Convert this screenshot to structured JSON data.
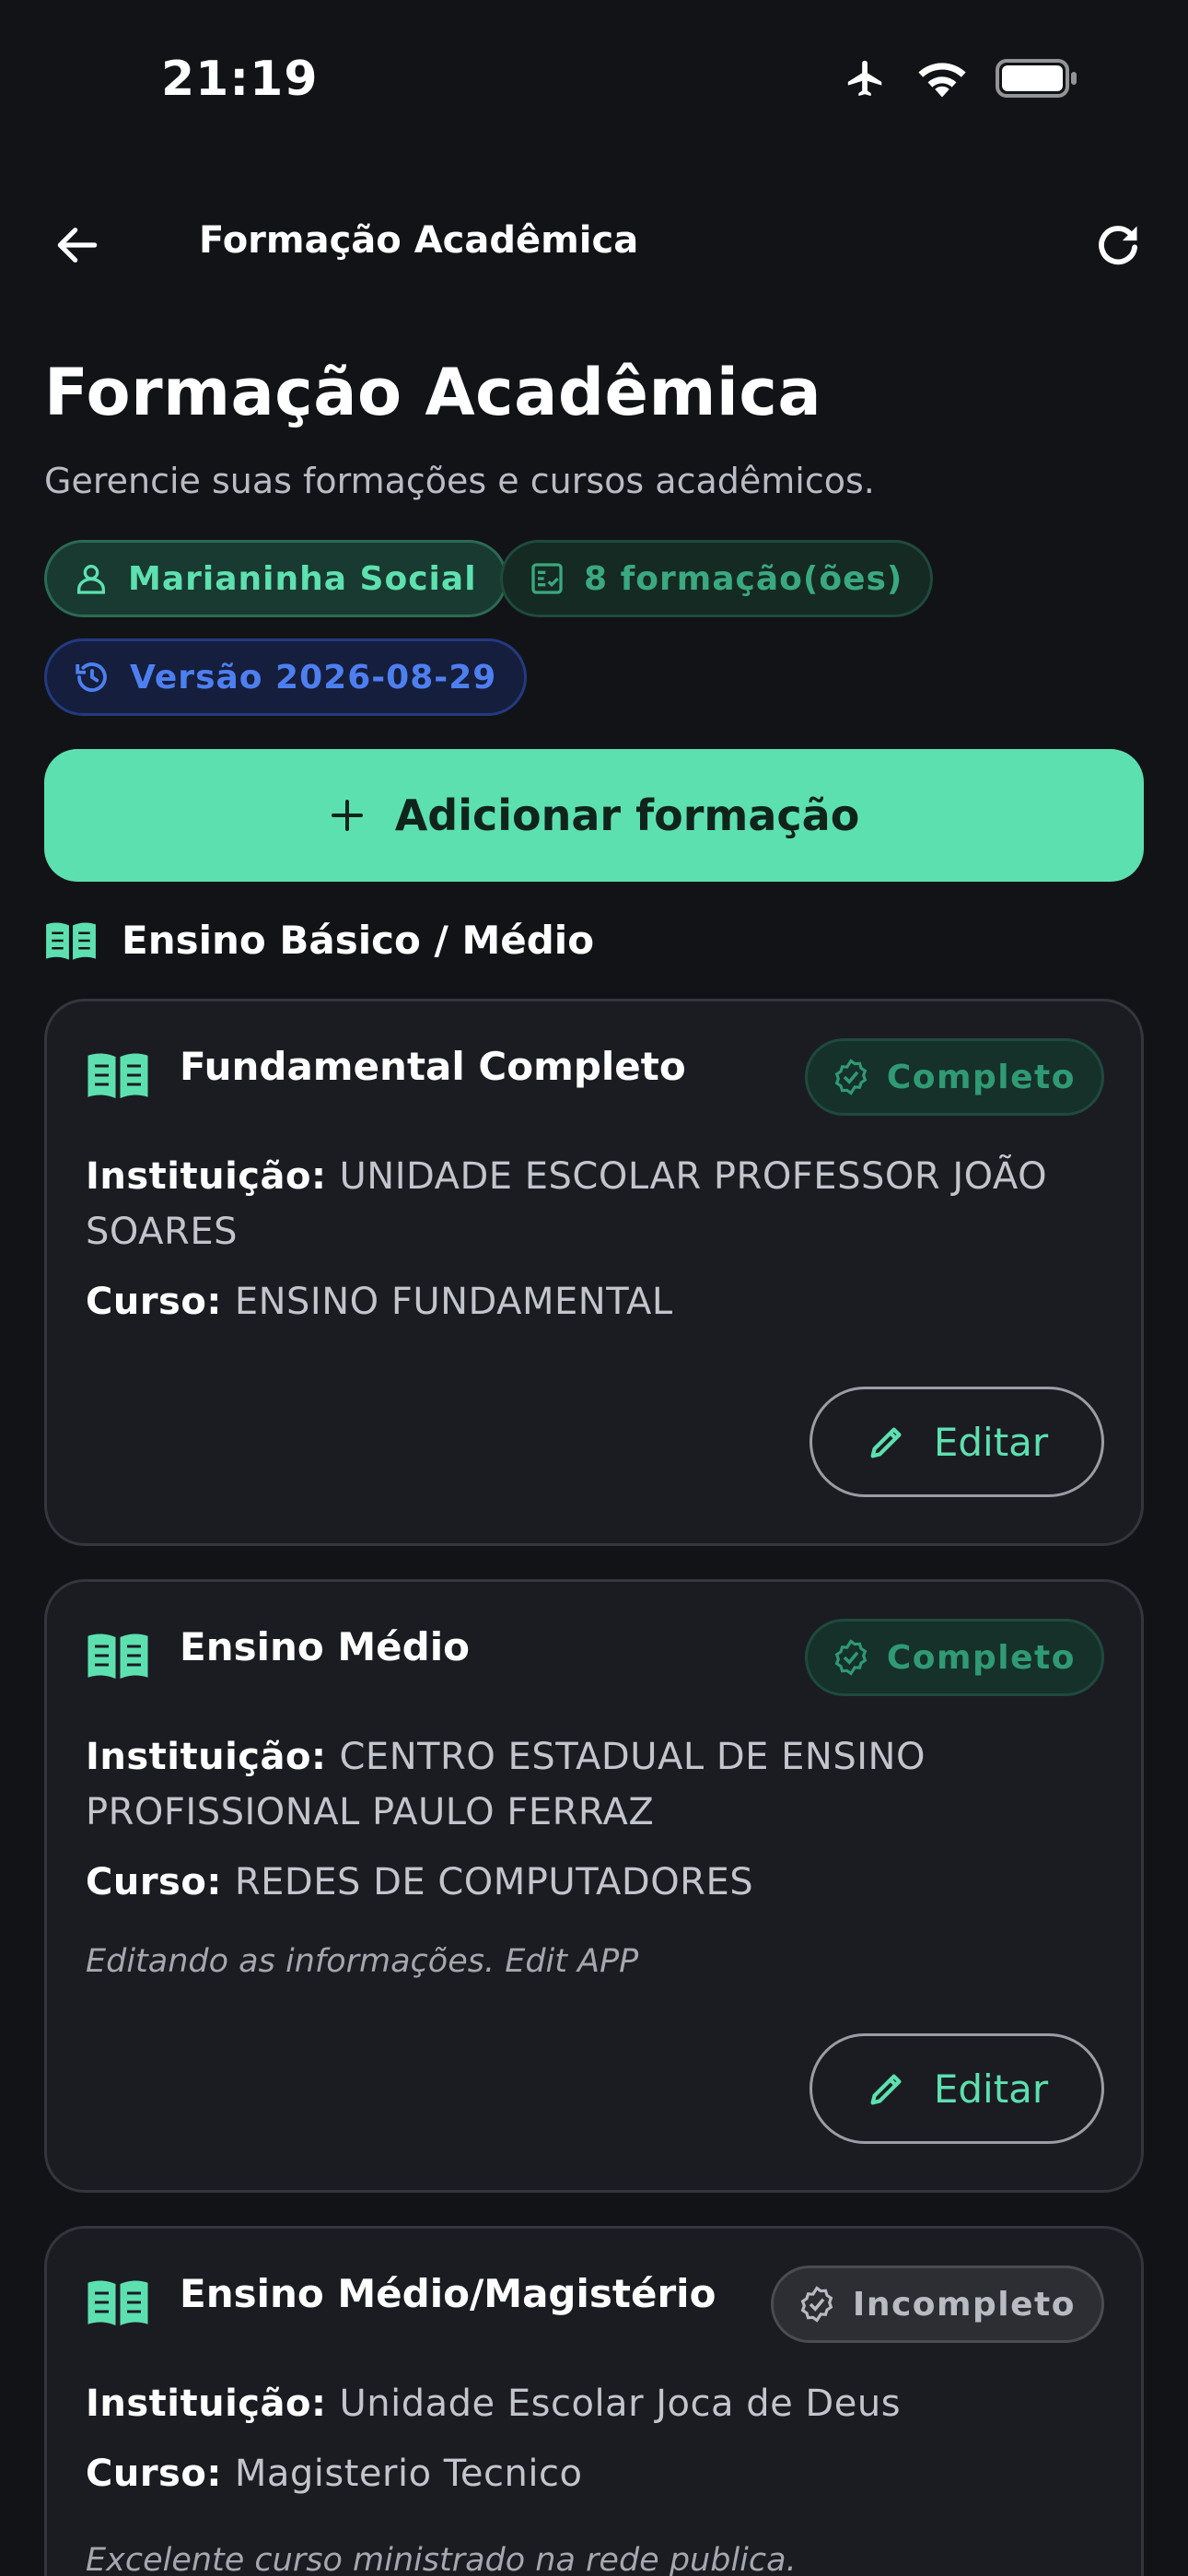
{
  "status_bar": {
    "time": "21:19"
  },
  "top_bar": {
    "title": "Formação Acadêmica"
  },
  "header": {
    "title": "Formação Acadêmica",
    "subtitle": "Gerencie suas formações e cursos acadêmicos.",
    "user_chip": "Marianinha Social",
    "count_chip": "8 formação(ões)",
    "version_chip": "Versão 2026-08-29"
  },
  "add_button": {
    "label": "Adicionar formação"
  },
  "section": {
    "title": "Ensino Básico / Médio"
  },
  "labels": {
    "institution": "Instituição:",
    "course": "Curso:",
    "edit": "Editar"
  },
  "cards": [
    {
      "title": "Fundamental Completo",
      "status": "Completo",
      "institution": "UNIDADE ESCOLAR PROFESSOR JOÃO SOARES",
      "course": "ENSINO FUNDAMENTAL"
    },
    {
      "title": "Ensino Médio",
      "status": "Completo",
      "institution": "CENTRO ESTADUAL DE ENSINO PROFISSIONAL PAULO FERRAZ",
      "course": "REDES DE COMPUTADORES",
      "note": "Editando as informações. Edit APP"
    },
    {
      "title": "Ensino Médio/Magistério",
      "status": "Incompleto",
      "institution": "Unidade Escolar Joca de Deus",
      "course": "Magisterio Tecnico",
      "note": "Excelente curso ministrado na rede publica."
    }
  ],
  "colors": {
    "background": "#121317",
    "accent": "#5de0b0",
    "card": "#1b1c22",
    "version_blue": "#4d7ff0"
  },
  "icons": {
    "back": "arrow-left-icon",
    "refresh": "refresh-icon",
    "user": "user-icon",
    "list": "checklist-icon",
    "version": "history-icon",
    "add": "plus-icon",
    "book": "open-book-icon",
    "verified": "verified-badge-icon",
    "edit": "pencil-icon",
    "airplane": "airplane-icon",
    "wifi": "wifi-icon",
    "battery": "battery-icon"
  }
}
